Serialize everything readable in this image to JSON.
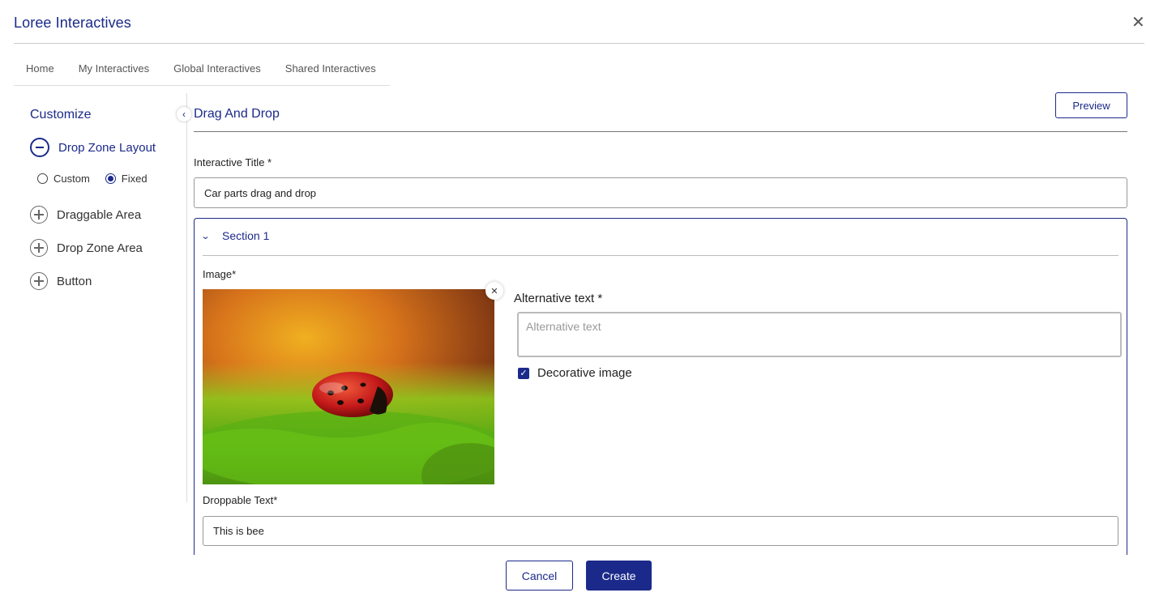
{
  "app": {
    "title": "Loree Interactives",
    "close_icon": "close-icon"
  },
  "tabs": [
    {
      "label": "Home"
    },
    {
      "label": "My Interactives"
    },
    {
      "label": "Global Interactives"
    },
    {
      "label": "Shared Interactives"
    }
  ],
  "sidebar": {
    "title": "Customize",
    "items": [
      {
        "label": "Drop Zone Layout",
        "icon": "minus-circle-icon",
        "expanded": true
      },
      {
        "label": "Draggable Area",
        "icon": "plus-circle-icon"
      },
      {
        "label": "Drop Zone Area",
        "icon": "plus-circle-icon"
      },
      {
        "label": "Button",
        "icon": "plus-circle-icon"
      }
    ],
    "layout_options": [
      {
        "label": "Custom",
        "selected": false
      },
      {
        "label": "Fixed",
        "selected": true
      }
    ]
  },
  "main": {
    "title": "Drag And Drop",
    "preview_label": "Preview",
    "title_field": {
      "label": "Interactive Title *",
      "value": "Car parts drag and drop"
    },
    "section": {
      "label": "Section 1",
      "image_label": "Image*",
      "alt_text_label": "Alternative text *",
      "alt_text_placeholder": "Alternative text",
      "decorative_label": "Decorative image",
      "decorative_checked": true,
      "droppable_label": "Droppable Text*",
      "droppable_value": "This is bee"
    }
  },
  "footer": {
    "cancel_label": "Cancel",
    "create_label": "Create"
  },
  "colors": {
    "primary": "#1b2a8a",
    "border": "#999999"
  }
}
